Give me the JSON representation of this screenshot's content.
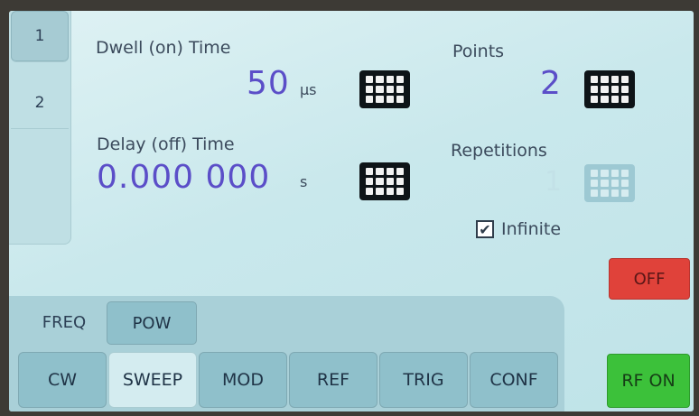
{
  "channels": [
    "1",
    "2"
  ],
  "dwell": {
    "label": "Dwell (on) Time",
    "value": "50",
    "unit": "µs"
  },
  "points": {
    "label": "Points",
    "value": "2"
  },
  "delay": {
    "label": "Delay (off) Time",
    "value": "0.000 000",
    "unit": "s"
  },
  "repetitions": {
    "label": "Repetitions",
    "value": "1"
  },
  "infinite": {
    "label": "Infinite",
    "checked": true,
    "check_glyph": "✔"
  },
  "off_button": {
    "label": "OFF",
    "color": "#e0423a"
  },
  "rf_on_button": {
    "label": "RF ON",
    "color": "#3cc13a"
  },
  "subtabs": [
    "FREQ",
    "POW"
  ],
  "main_tabs": [
    "CW",
    "SWEEP",
    "MOD",
    "REF",
    "TRIG",
    "CONF"
  ],
  "active_main_tab": "SWEEP",
  "accent": "#5b4ec8"
}
